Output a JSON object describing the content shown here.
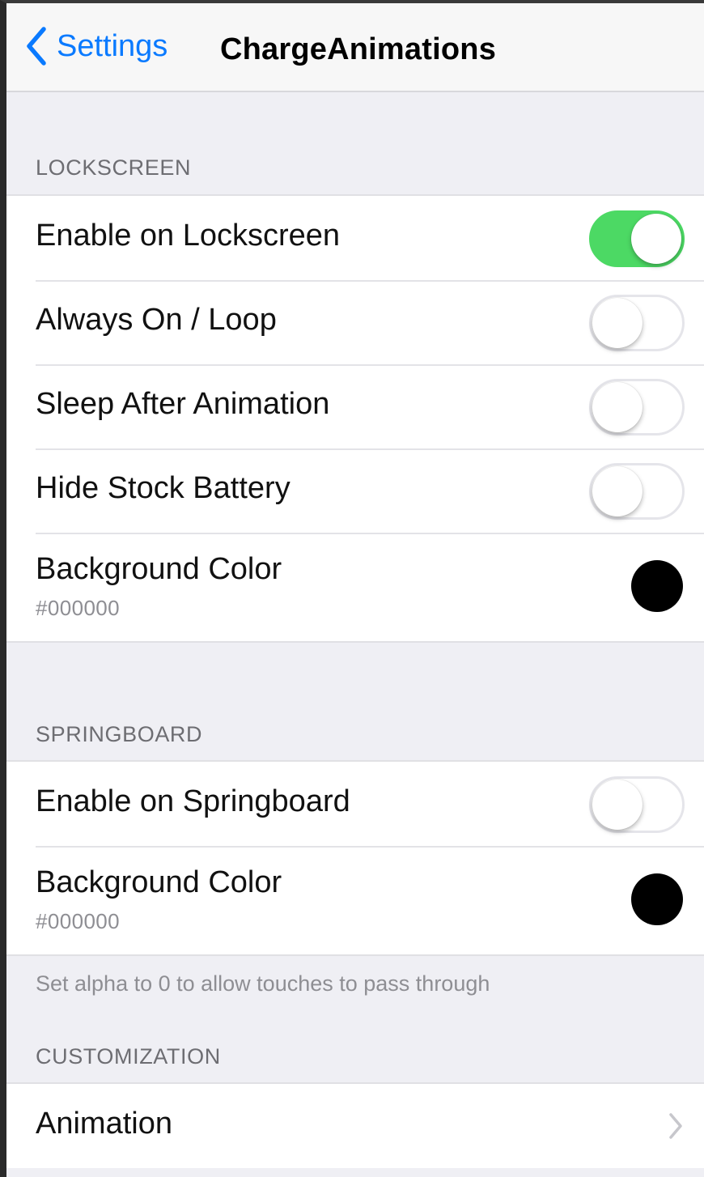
{
  "nav": {
    "back_label": "Settings",
    "title": "ChargeAnimations"
  },
  "lockscreen": {
    "header": "LOCKSCREEN",
    "rows": [
      {
        "label": "Enable on Lockscreen",
        "enabled": true
      },
      {
        "label": "Always On / Loop",
        "enabled": false
      },
      {
        "label": "Sleep After Animation",
        "enabled": false
      },
      {
        "label": "Hide Stock Battery",
        "enabled": false
      }
    ],
    "color_row": {
      "label": "Background Color",
      "value": "#000000"
    }
  },
  "springboard": {
    "header": "SPRINGBOARD",
    "rows": [
      {
        "label": "Enable on Springboard",
        "enabled": false
      }
    ],
    "color_row": {
      "label": "Background Color",
      "value": "#000000"
    },
    "footer": "Set alpha to 0 to allow touches to pass through"
  },
  "customization": {
    "header": "CUSTOMIZATION",
    "rows": [
      {
        "label": "Animation"
      }
    ]
  },
  "colors": {
    "accent": "#0a7aff",
    "toggle_on": "#4cd964",
    "group_background": "#efeff4"
  },
  "icons": {
    "back": "chevron-left-icon",
    "disclosure": "chevron-right-icon"
  }
}
